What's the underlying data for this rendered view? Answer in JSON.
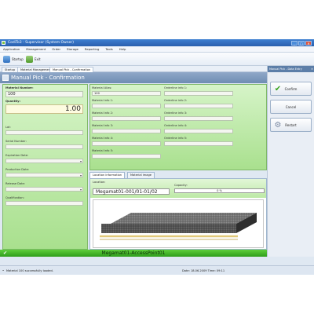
{
  "window": {
    "title": "CodiTo3 - Supervisor (System Owner)",
    "minimize": "_",
    "maximize": "□",
    "close": "✕"
  },
  "menu": [
    "Application",
    "Management",
    "Order",
    "Storage",
    "Reporting",
    "Tools",
    "Help"
  ],
  "toolbar": {
    "startup_label": "Startup",
    "exit_label": "Exit"
  },
  "tabs": [
    "Startup",
    "Material Management",
    "Manual Pick - Confirmation"
  ],
  "banner": {
    "title": "Manual Pick - Confirmation"
  },
  "left_form": {
    "material_number_label": "Material Number:",
    "material_number_value": "100",
    "quantity_label": "Quantity:",
    "quantity_value": "1.00",
    "lot_label": "Lot:",
    "serial_label": "Serial Number:",
    "expiration_label": "Expiration Date:",
    "production_label": "Production Date:",
    "release_label": "Release Date:",
    "qualification_label": "Qualification:"
  },
  "info_form": {
    "alias_label": "Material Alias:",
    "alias_value": "100",
    "info1_label": "Material info 1:",
    "info2_label": "Material info 2:",
    "info3_label": "Material info 3:",
    "info4_label": "Material info 4:",
    "info5_label": "Material info 5:",
    "ol1_label": "Orderline info 1:",
    "ol2_label": "Orderline info 2:",
    "ol3_label": "Orderline info 3:",
    "ol4_label": "Orderline info 4:",
    "ol5_label": "Orderline info 5:"
  },
  "detail_tabs": [
    "Location information",
    "Material image"
  ],
  "location": {
    "location_label": "Location:",
    "location_value": "Megamat01-001/01-01/02",
    "capacity_label": "Capacity:",
    "capacity_value": "0 %"
  },
  "bottom_bar": {
    "text": "Megamat01-AccessPoint01"
  },
  "right_panel": {
    "title": "Manual Pick - Data Entry",
    "close": "✕",
    "confirm_label": "Confirm",
    "cancel_label": "Cancel",
    "restart_label": "Restart"
  },
  "status": {
    "message": "Material 100 successfully loaded.",
    "date": "Date: 18.06.2009 Time: 09:11"
  },
  "colors": {
    "title_bar": "#2f69b8",
    "green_pane": "#b7e7a0",
    "bottom_bar": "#3aae22",
    "status_bar": "#dde6f1"
  }
}
